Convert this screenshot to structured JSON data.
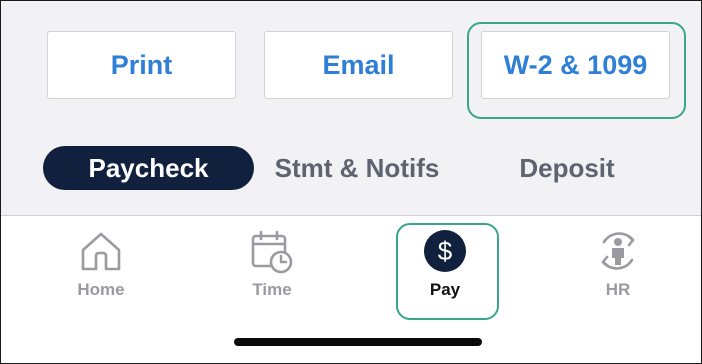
{
  "actions": {
    "print_label": "Print",
    "email_label": "Email",
    "w2_label": "W-2 & 1099"
  },
  "tabs": [
    {
      "label": "Paycheck",
      "selected": true
    },
    {
      "label": "Stmt & Notifs",
      "selected": false
    },
    {
      "label": "Deposit",
      "selected": false
    }
  ],
  "bottom_nav": [
    {
      "label": "Home",
      "icon": "home-icon",
      "selected": false
    },
    {
      "label": "Time",
      "icon": "calendar-clock-icon",
      "selected": false
    },
    {
      "label": "Pay",
      "icon": "dollar-circle-icon",
      "selected": true
    },
    {
      "label": "HR",
      "icon": "person-sync-icon",
      "selected": false
    }
  ],
  "colors": {
    "accent_text": "#2f7fd6",
    "selected_tab_bg": "#10203d",
    "highlight_outline": "#3aa58d",
    "inactive_icon": "#9a9aa0"
  }
}
